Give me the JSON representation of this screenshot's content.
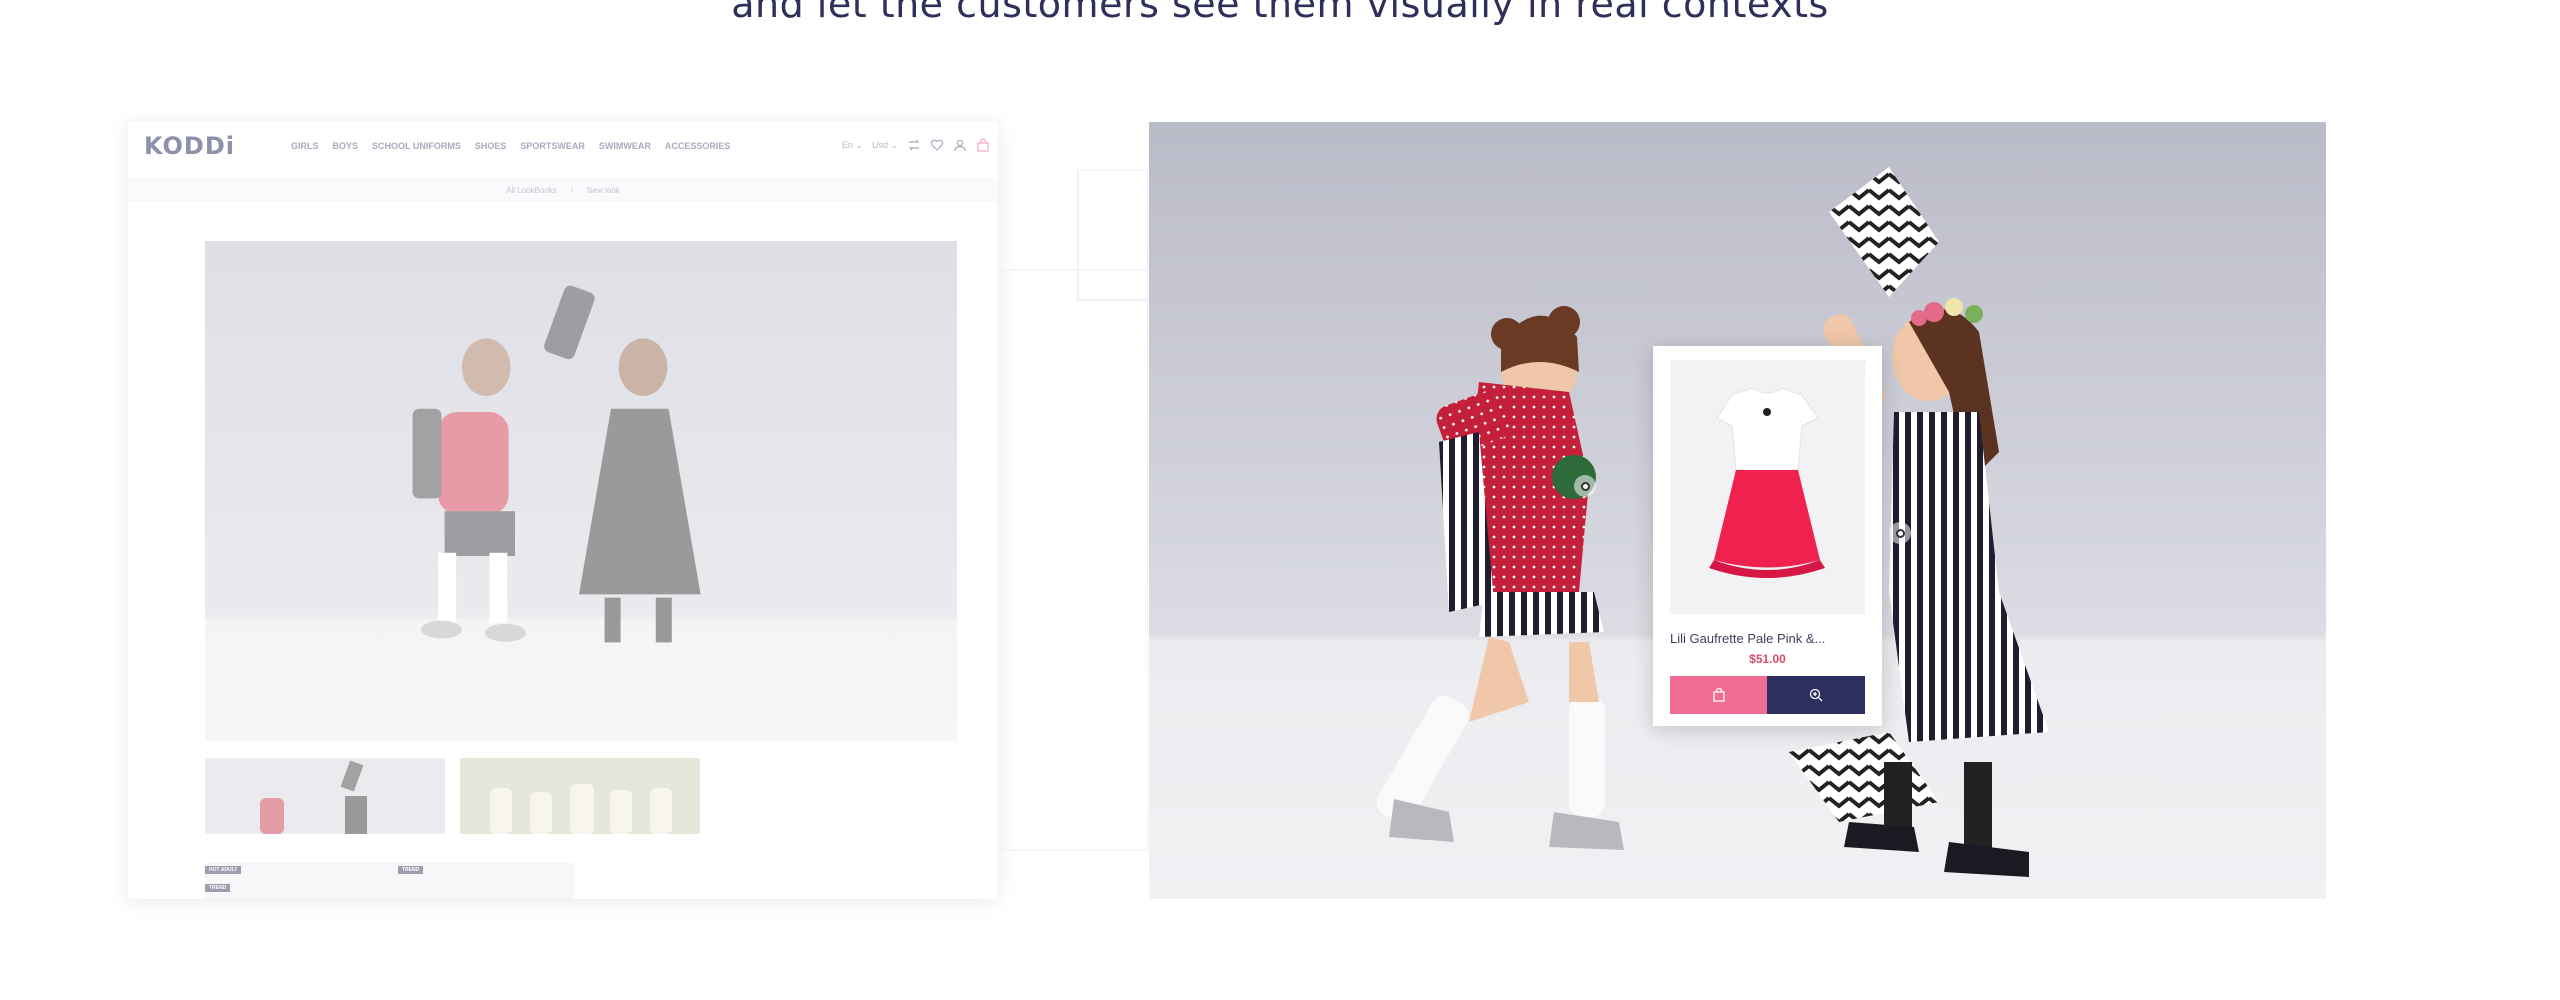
{
  "headline": "and let the customers see them visually in real contexts",
  "left_mock": {
    "logo": "KODDi",
    "menu": [
      "GIRLS",
      "BOYS",
      "SCHOOL UNIFORMS",
      "SHOES",
      "SPORTSWEAR",
      "SWIMWEAR",
      "ACCESSORIES"
    ],
    "language": "En ⌄",
    "currency": "Usd ⌄",
    "compare_count": "0",
    "breadcrumb": [
      "All LookBooks",
      "/",
      "New look"
    ],
    "tags": [
      "HOT ADULT",
      "TREND",
      "TREND"
    ]
  },
  "popup": {
    "product_name": "Lili Gaufrette Pale Pink &...",
    "price": "$51.00"
  },
  "icons": {
    "close": "close-icon",
    "cart": "bag-icon",
    "zoom": "zoom-in-icon"
  },
  "colors": {
    "cart_button": "#f06c92",
    "zoom_button": "#2d2f5e",
    "price": "#d64c6f",
    "headline": "#2e2f5a"
  }
}
